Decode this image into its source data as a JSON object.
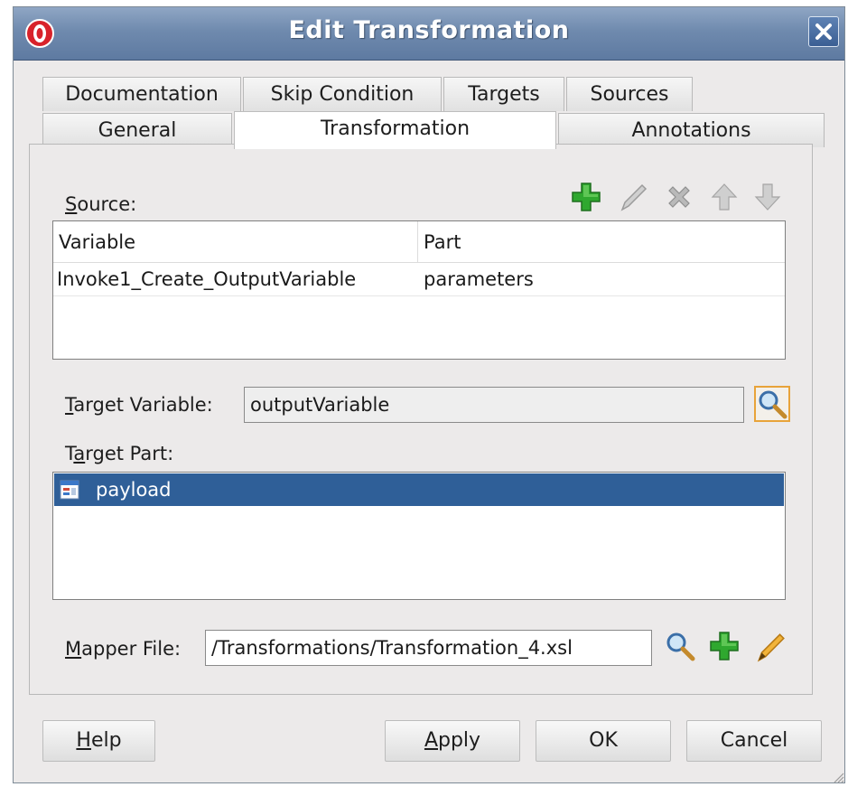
{
  "window": {
    "title": "Edit Transformation"
  },
  "tabs": {
    "row1": [
      "Documentation",
      "Skip Condition",
      "Targets",
      "Sources"
    ],
    "row2": [
      "General",
      "Transformation",
      "Annotations"
    ],
    "active": "Transformation"
  },
  "source": {
    "label_mnemonic": "S",
    "label_rest": "ource:",
    "columns": [
      "Variable",
      "Part"
    ],
    "rows": [
      {
        "variable": "Invoke1_Create_OutputVariable",
        "part": "parameters"
      }
    ],
    "toolbar_icons": [
      "add-icon",
      "edit-icon",
      "delete-icon",
      "move-up-icon",
      "move-down-icon"
    ]
  },
  "target_variable": {
    "label_mnemonic": "T",
    "label_rest": "arget Variable:",
    "value": "outputVariable",
    "browse_icon": "search-icon"
  },
  "target_part": {
    "label_pre": "T",
    "label_mnemonic": "a",
    "label_rest": "rget Part:",
    "items": [
      {
        "name": "payload",
        "icon": "element-icon",
        "selected": true
      }
    ]
  },
  "mapper_file": {
    "label_mnemonic": "M",
    "label_rest": "apper File:",
    "value": "/Transformations/Transformation_4.xsl",
    "icons": [
      "search-icon",
      "add-icon",
      "edit-icon"
    ]
  },
  "buttons": {
    "help_mnemonic": "H",
    "help_rest": "elp",
    "apply_mnemonic": "A",
    "apply_rest": "pply",
    "ok": "OK",
    "cancel": "Cancel"
  },
  "colors": {
    "titlebar": "#6f8aae",
    "selection": "#2f5f98",
    "add_green": "#2fa82f",
    "search_frame": "#e8a33a"
  }
}
